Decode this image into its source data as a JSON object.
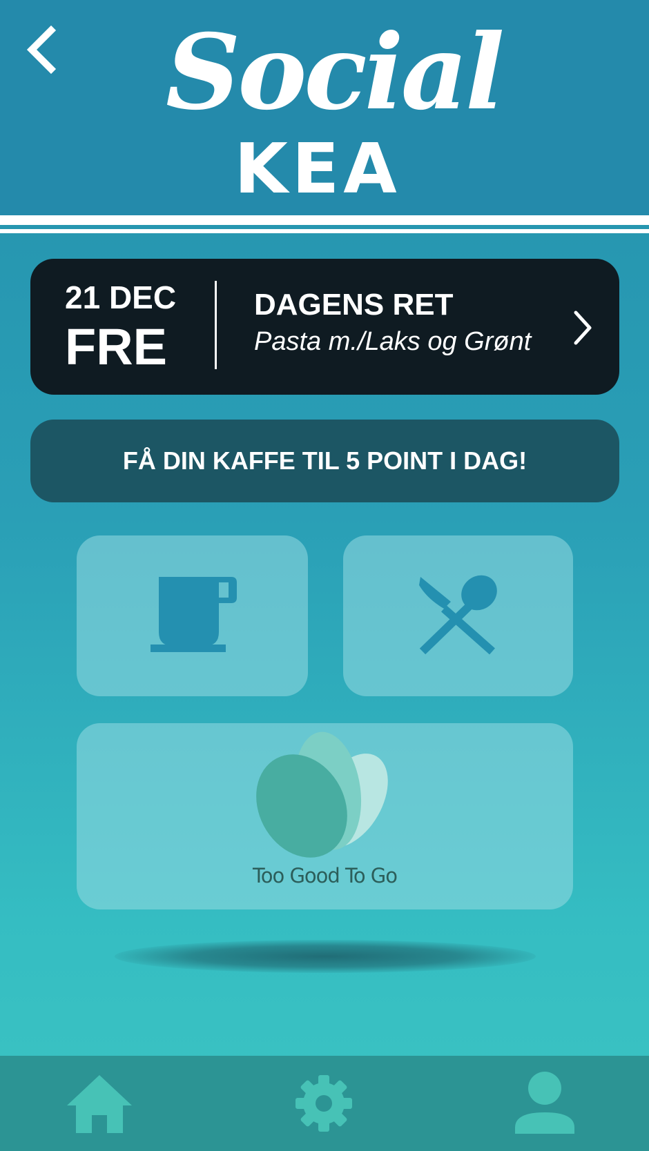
{
  "header": {
    "logo_line1": "Social",
    "logo_line2": "KEA"
  },
  "dish": {
    "date_day_month": "21 DEC",
    "weekday": "FRE",
    "title": "DAGENS RET",
    "subtitle": "Pasta m./Laks og Grønt"
  },
  "promo": {
    "text": "FÅ DIN KAFFE TIL 5 POINT I DAG!"
  },
  "tiles": {
    "tgtg_label": "Too Good To Go"
  },
  "icons": {
    "back": "chevron-left-icon",
    "dish_arrow": "chevron-right-icon",
    "coffee": "coffee-cup-icon",
    "food": "cutlery-icon",
    "tgtg": "tgtg-leaves-logo",
    "home": "home-icon",
    "settings": "gear-icon",
    "profile": "user-icon"
  },
  "colors": {
    "header_bg": "#248aab",
    "dish_card_bg": "#0f1b22",
    "promo_bg": "#1c5664",
    "icon_teal": "#2490b0",
    "nav_bg": "#2c9494",
    "nav_icon": "#47c2b6"
  }
}
